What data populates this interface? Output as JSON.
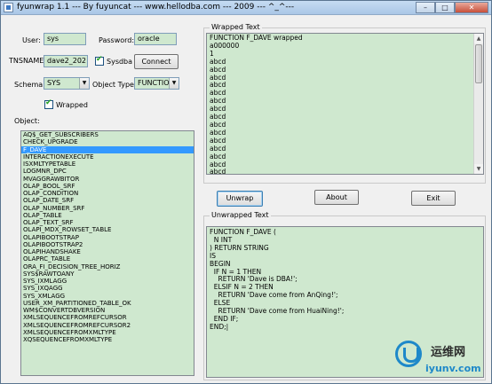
{
  "window": {
    "title": "fyunwrap 1.1 --- By fuyuncat --- www.hellodba.com --- 2009 --- ^_^---",
    "minimize_glyph": "–",
    "maximize_glyph": "□",
    "close_glyph": "✕"
  },
  "login": {
    "user_label": "User:",
    "user_value": "sys",
    "password_label": "Password:",
    "password_value": "oracle",
    "tnsname_label": "TNSNAME:",
    "tnsname_value": "dave2_202",
    "sysdba_label": "Sysdba",
    "sysdba_checked": true,
    "connect_label": "Connect"
  },
  "filters": {
    "schema_label": "Schema:",
    "schema_value": "SYS",
    "object_type_label": "Object Type:",
    "object_type_value": "FUNCTION",
    "wrapped_label": "Wrapped",
    "wrapped_checked": true
  },
  "object_list": {
    "label": "Object:",
    "selected_index": 2,
    "items": [
      "AQ$_GET_SUBSCRIBERS",
      "CHECK_UPGRADE",
      "F_DAVE",
      "INTERACTIONEXECUTE",
      "ISXMLTYPETABLE",
      "LOGMNR_DPC",
      "MVAGGRAWBITOR",
      "OLAP_BOOL_SRF",
      "OLAP_CONDITION",
      "OLAP_DATE_SRF",
      "OLAP_NUMBER_SRF",
      "OLAP_TABLE",
      "OLAP_TEXT_SRF",
      "OLAPI_MDX_ROWSET_TABLE",
      "OLAPIBOOTSTRAP",
      "OLAPIBOOTSTRAP2",
      "OLAPIHANDSHAKE",
      "OLAPRC_TABLE",
      "ORA_FI_DECISION_TREE_HORIZ",
      "SYS$RAWTOANY",
      "SYS_IXMLAGG",
      "SYS_IXQAGG",
      "SYS_XMLAGG",
      "USER_XM_PARTITIONED_TABLE_OK",
      "WM$CONVERTDBVERSION",
      "XMLSEQUENCEFROMREFCURSOR",
      "XMLSEQUENCEFROMREFCURSOR2",
      "XMLSEQUENCEFROMXMLTYPE",
      "XQSEQUENCEFROMXMLTYPE"
    ]
  },
  "wrapped_text": {
    "title": "Wrapped Text",
    "lines": [
      "FUNCTION F_DAVE wrapped",
      "a000000",
      "1",
      "abcd",
      "abcd",
      "abcd",
      "abcd",
      "abcd",
      "abcd",
      "abcd",
      "abcd",
      "abcd",
      "abcd",
      "abcd",
      "abcd",
      "abcd",
      "abcd",
      "abcd",
      "abcd"
    ]
  },
  "actions": {
    "unwrap_label": "Unwrap",
    "about_label": "About",
    "exit_label": "Exit"
  },
  "unwrapped_text": {
    "title": "Unwrapped Text",
    "lines": [
      "FUNCTION F_DAVE (",
      "  N INT",
      ") RETURN STRING",
      "IS",
      "BEGIN",
      "  IF N = 1 THEN",
      "    RETURN 'Dave is DBA!';",
      "  ELSIF N = 2 THEN",
      "    RETURN 'Dave come from AnQing!';",
      "  ELSE",
      "    RETURN 'Dave come from HuaiNing!';",
      "  END IF;",
      "END;|"
    ]
  },
  "watermark": {
    "brand_cn": "运维网",
    "url": "iyunv.com"
  }
}
